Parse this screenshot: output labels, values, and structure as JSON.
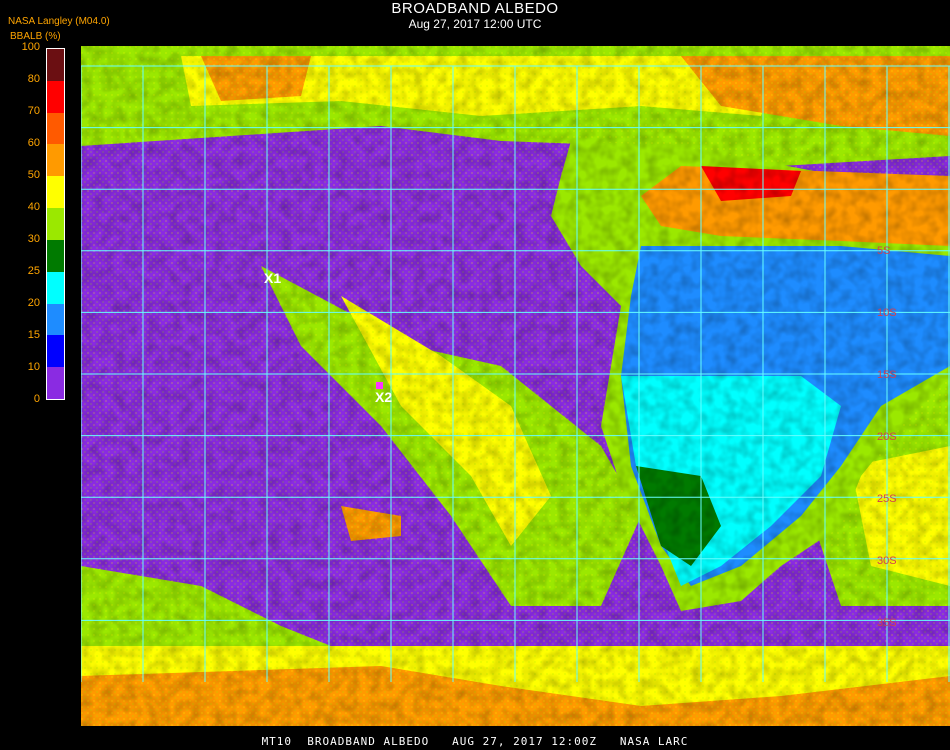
{
  "title": "BROADBAND ALBEDO",
  "subtitle": "Aug 27, 2017 12:00 UTC",
  "credit": "NASA Langley (M04.0)",
  "colorbar": {
    "unit_label": "BBALB (%)",
    "ticks": [
      "100",
      "80",
      "70",
      "60",
      "50",
      "40",
      "30",
      "25",
      "20",
      "15",
      "10",
      "0"
    ],
    "colors": [
      "#6b0f12",
      "#ff0000",
      "#ff5a00",
      "#ff9a00",
      "#ffff00",
      "#9be800",
      "#007a00",
      "#00ffff",
      "#1e8cff",
      "#0000ff",
      "#8a2be2"
    ]
  },
  "map": {
    "markers": [
      {
        "label": "X1"
      },
      {
        "label": "X2"
      }
    ],
    "lat_labels": [
      "5S",
      "10S",
      "15S",
      "20S",
      "25S",
      "30S",
      "35S"
    ],
    "surface_colors": {
      "ocean": "#8a2be2",
      "land_low": "#00ffff",
      "land_mid": "#1e8cff",
      "cloud_low": "#9be800",
      "cloud_mid": "#ffff00",
      "cloud_high": "#ff9a00",
      "cloud_max": "#ff0000",
      "veg": "#007a00",
      "grid": "#66ffff"
    }
  },
  "footer": "MT10  BROADBAND ALBEDO   AUG 27, 2017 12:00Z   NASA LARC"
}
